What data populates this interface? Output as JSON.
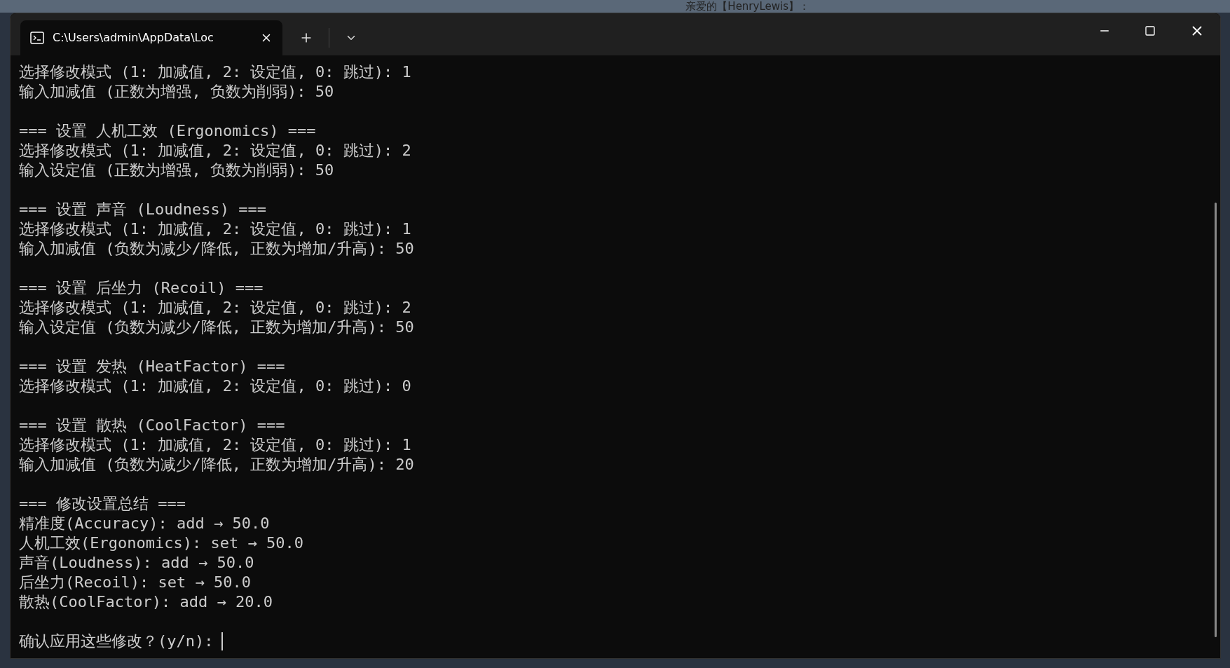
{
  "desktop": {
    "caption": "亲爱的【HenryLewis】："
  },
  "tab": {
    "title": "C:\\Users\\admin\\AppData\\Loc",
    "selected": true
  },
  "blocks": [
    [
      "选择修改模式 (1: 加减值, 2: 设定值, 0: 跳过): 1",
      "输入加减值 (正数为增强, 负数为削弱): 50"
    ],
    [
      "=== 设置 人机工效 (Ergonomics) ===",
      "选择修改模式 (1: 加减值, 2: 设定值, 0: 跳过): 2",
      "输入设定值 (正数为增强, 负数为削弱): 50"
    ],
    [
      "=== 设置 声音 (Loudness) ===",
      "选择修改模式 (1: 加减值, 2: 设定值, 0: 跳过): 1",
      "输入加减值 (负数为减少/降低, 正数为增加/升高): 50"
    ],
    [
      "=== 设置 后坐力 (Recoil) ===",
      "选择修改模式 (1: 加减值, 2: 设定值, 0: 跳过): 2",
      "输入设定值 (负数为减少/降低, 正数为增加/升高): 50"
    ],
    [
      "=== 设置 发热 (HeatFactor) ===",
      "选择修改模式 (1: 加减值, 2: 设定值, 0: 跳过): 0"
    ],
    [
      "=== 设置 散热 (CoolFactor) ===",
      "选择修改模式 (1: 加减值, 2: 设定值, 0: 跳过): 1",
      "输入加减值 (负数为减少/降低, 正数为增加/升高): 20"
    ],
    [
      "=== 修改设置总结 ===",
      "精准度(Accuracy): add → 50.0",
      "人机工效(Ergonomics): set → 50.0",
      "声音(Loudness): add → 50.0",
      "后坐力(Recoil): set → 50.0",
      "散热(CoolFactor): add → 20.0"
    ]
  ],
  "prompt": "确认应用这些修改？(y/n):"
}
